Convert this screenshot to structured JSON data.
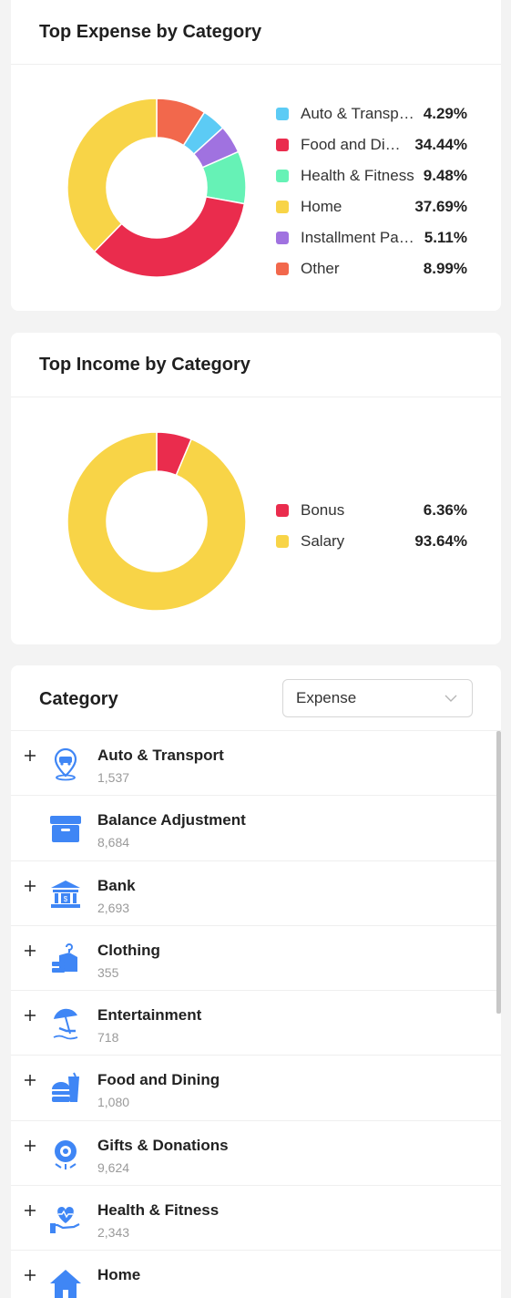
{
  "expense_card": {
    "title": "Top Expense by Category",
    "legend": [
      {
        "label": "Auto & Transport",
        "value": "4.29%",
        "color": "#5ccbf5"
      },
      {
        "label": "Food and Dining",
        "value": "34.44%",
        "color": "#ea2c4d"
      },
      {
        "label": "Health & Fitness",
        "value": "9.48%",
        "color": "#66f2b6"
      },
      {
        "label": "Home",
        "value": "37.69%",
        "color": "#f8d447"
      },
      {
        "label": "Installment Payment",
        "value": "5.11%",
        "color": "#a072e0"
      },
      {
        "label": "Other",
        "value": "8.99%",
        "color": "#f2684c"
      }
    ]
  },
  "income_card": {
    "title": "Top Income by Category",
    "legend": [
      {
        "label": "Bonus",
        "value": "6.36%",
        "color": "#ea2c4d"
      },
      {
        "label": "Salary",
        "value": "93.64%",
        "color": "#f8d447"
      }
    ]
  },
  "chart_data": [
    {
      "type": "pie",
      "title": "Top Expense by Category",
      "categories": [
        "Auto & Transport",
        "Food and Dining",
        "Health & Fitness",
        "Home",
        "Installment Payment",
        "Other"
      ],
      "values": [
        4.29,
        34.44,
        9.48,
        37.69,
        5.11,
        8.99
      ],
      "slice_order_clockwise_from_top": [
        "Other",
        "Auto & Transport",
        "Installment Payment",
        "Health & Fitness",
        "Food and Dining",
        "Home"
      ],
      "donut": true,
      "legend": "right"
    },
    {
      "type": "pie",
      "title": "Top Income by Category",
      "categories": [
        "Bonus",
        "Salary"
      ],
      "values": [
        6.36,
        93.64
      ],
      "slice_order_clockwise_from_top": [
        "Bonus",
        "Salary"
      ],
      "donut": true,
      "legend": "right"
    }
  ],
  "category_card": {
    "title": "Category",
    "filter": {
      "selected": "Expense"
    },
    "accent_color": "#3f86f5",
    "rows": [
      {
        "name": "Auto & Transport",
        "count": "1,537",
        "icon": "location-car-icon",
        "expandable": true
      },
      {
        "name": "Balance Adjustment",
        "count": "8,684",
        "icon": "archive-box-icon",
        "expandable": false
      },
      {
        "name": "Bank",
        "count": "2,693",
        "icon": "bank-icon",
        "expandable": true
      },
      {
        "name": "Clothing",
        "count": "355",
        "icon": "clothes-hanger-icon",
        "expandable": true
      },
      {
        "name": "Entertainment",
        "count": "718",
        "icon": "beach-umbrella-icon",
        "expandable": true
      },
      {
        "name": "Food and Dining",
        "count": "1,080",
        "icon": "burger-drink-icon",
        "expandable": true
      },
      {
        "name": "Gifts & Donations",
        "count": "9,624",
        "icon": "donation-icon",
        "expandable": true
      },
      {
        "name": "Health & Fitness",
        "count": "2,343",
        "icon": "heart-hand-icon",
        "expandable": true
      },
      {
        "name": "Home",
        "count": "",
        "icon": "home-icon",
        "expandable": true
      }
    ]
  }
}
